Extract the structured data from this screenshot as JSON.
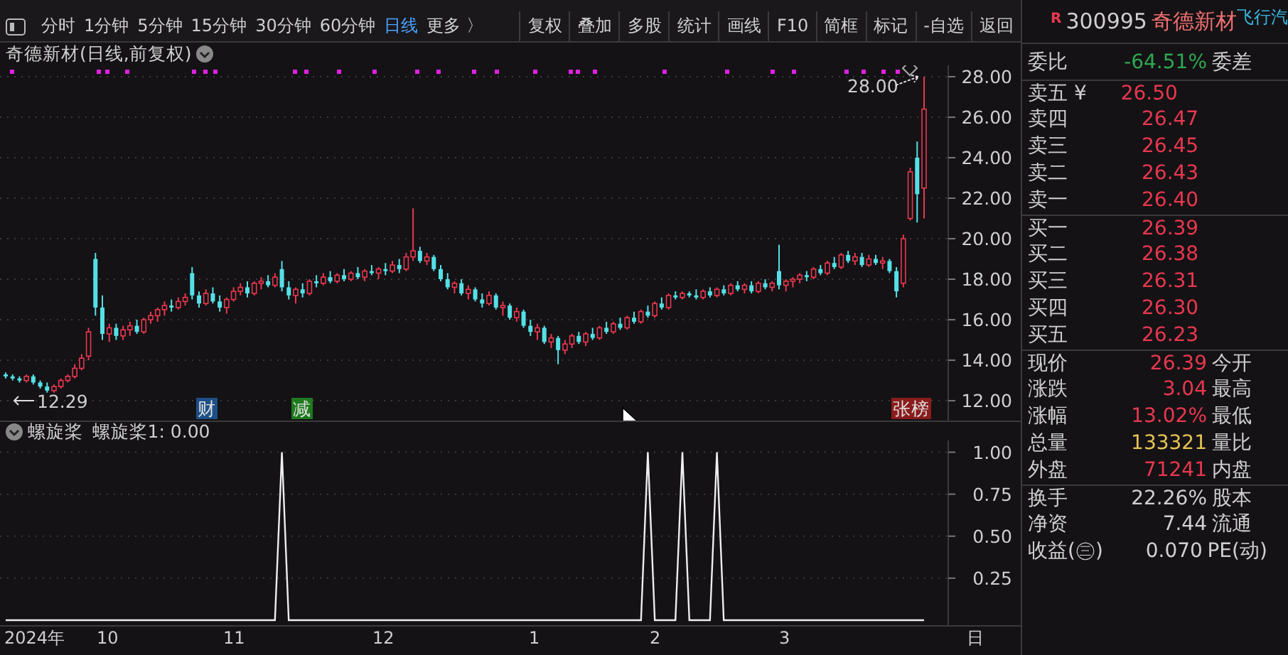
{
  "toolbar": {
    "periods": [
      {
        "label": "分时",
        "selected": false
      },
      {
        "label": "1分钟",
        "selected": false
      },
      {
        "label": "5分钟",
        "selected": false
      },
      {
        "label": "15分钟",
        "selected": false
      },
      {
        "label": "30分钟",
        "selected": false
      },
      {
        "label": "60分钟",
        "selected": false
      },
      {
        "label": "日线",
        "selected": true
      },
      {
        "label": "更多 〉",
        "selected": false
      }
    ],
    "buttons": [
      "复权",
      "叠加",
      "多股",
      "统计",
      "画线",
      "F10",
      "简框",
      "标记",
      "-自选",
      "返回"
    ]
  },
  "chart": {
    "title": "奇德新材(日线,前复权)",
    "high_label": "28.00",
    "low_label": "12.29",
    "chart_data": {
      "type": "candlestick",
      "grid": true,
      "ylim": [
        11.02,
        28.56
      ],
      "yticks": [
        {
          "value": 28,
          "label": "28.00"
        },
        {
          "value": 26,
          "label": "26.00"
        },
        {
          "value": 24,
          "label": "24.00"
        },
        {
          "value": 22,
          "label": "22.00"
        },
        {
          "value": 20,
          "label": "20.00"
        },
        {
          "value": 18,
          "label": "18.00"
        },
        {
          "value": 16,
          "label": "16.00"
        },
        {
          "value": 14,
          "label": "14.00"
        },
        {
          "value": 12,
          "label": "12.00"
        }
      ],
      "ohlc": [
        [
          13.3,
          13.4,
          13.1,
          13.2
        ],
        [
          13.2,
          13.3,
          13.0,
          13.1
        ],
        [
          13.1,
          13.2,
          12.9,
          13.0
        ],
        [
          13.0,
          13.3,
          12.9,
          13.2
        ],
        [
          13.2,
          13.3,
          12.8,
          12.9
        ],
        [
          12.9,
          13.0,
          12.6,
          12.7
        ],
        [
          12.7,
          12.9,
          12.4,
          12.5
        ],
        [
          12.5,
          12.8,
          12.4,
          12.7
        ],
        [
          12.7,
          13.1,
          12.6,
          13.0
        ],
        [
          13.0,
          13.3,
          12.9,
          13.2
        ],
        [
          13.2,
          13.8,
          13.1,
          13.6
        ],
        [
          13.6,
          14.3,
          13.5,
          14.1
        ],
        [
          14.2,
          15.6,
          14.0,
          15.4
        ],
        [
          19.0,
          19.3,
          16.2,
          16.6
        ],
        [
          16.6,
          17.2,
          15.0,
          15.3
        ],
        [
          15.3,
          15.8,
          14.9,
          15.6
        ],
        [
          15.6,
          15.8,
          15.0,
          15.2
        ],
        [
          15.2,
          15.7,
          15.0,
          15.5
        ],
        [
          15.5,
          15.9,
          15.2,
          15.7
        ],
        [
          15.7,
          16.0,
          15.3,
          15.4
        ],
        [
          15.4,
          16.1,
          15.3,
          16.0
        ],
        [
          16.0,
          16.4,
          15.8,
          16.2
        ],
        [
          16.2,
          16.6,
          15.9,
          16.5
        ],
        [
          16.5,
          16.9,
          16.2,
          16.7
        ],
        [
          16.7,
          17.0,
          16.4,
          16.6
        ],
        [
          16.6,
          17.1,
          16.5,
          16.9
        ],
        [
          16.9,
          17.3,
          16.7,
          17.1
        ],
        [
          18.3,
          18.6,
          17.0,
          17.2
        ],
        [
          17.2,
          17.4,
          16.6,
          16.8
        ],
        [
          16.8,
          17.5,
          16.7,
          17.3
        ],
        [
          17.3,
          17.6,
          16.8,
          16.9
        ],
        [
          16.9,
          17.2,
          16.4,
          16.6
        ],
        [
          16.6,
          17.1,
          16.3,
          17.0
        ],
        [
          17.0,
          17.6,
          16.9,
          17.4
        ],
        [
          17.4,
          17.8,
          17.2,
          17.6
        ],
        [
          17.6,
          17.9,
          17.1,
          17.3
        ],
        [
          17.3,
          17.9,
          17.2,
          17.8
        ],
        [
          17.8,
          18.1,
          17.5,
          17.9
        ],
        [
          17.9,
          18.2,
          17.6,
          17.7
        ],
        [
          17.7,
          18.3,
          17.6,
          18.1
        ],
        [
          18.5,
          18.9,
          17.4,
          17.6
        ],
        [
          17.6,
          17.9,
          17.0,
          17.2
        ],
        [
          17.2,
          17.6,
          16.8,
          17.5
        ],
        [
          17.5,
          17.8,
          17.1,
          17.3
        ],
        [
          17.3,
          18.0,
          17.2,
          17.9
        ],
        [
          17.9,
          18.2,
          17.6,
          17.8
        ],
        [
          17.8,
          18.3,
          17.7,
          18.1
        ],
        [
          18.1,
          18.4,
          17.8,
          17.9
        ],
        [
          17.9,
          18.3,
          17.8,
          18.2
        ],
        [
          18.2,
          18.5,
          17.9,
          18.0
        ],
        [
          18.0,
          18.4,
          17.9,
          18.3
        ],
        [
          18.3,
          18.6,
          18.0,
          18.1
        ],
        [
          18.1,
          18.5,
          17.9,
          18.4
        ],
        [
          18.4,
          18.7,
          18.2,
          18.3
        ],
        [
          18.3,
          18.6,
          18.0,
          18.5
        ],
        [
          18.5,
          18.8,
          18.2,
          18.4
        ],
        [
          18.4,
          18.9,
          18.3,
          18.7
        ],
        [
          18.7,
          19.0,
          18.3,
          18.5
        ],
        [
          18.5,
          19.3,
          18.4,
          19.1
        ],
        [
          19.1,
          21.5,
          18.9,
          19.4
        ],
        [
          19.4,
          19.6,
          18.8,
          18.9
        ],
        [
          18.9,
          19.3,
          18.7,
          19.1
        ],
        [
          19.1,
          19.2,
          18.4,
          18.5
        ],
        [
          18.5,
          18.7,
          17.9,
          18.0
        ],
        [
          18.0,
          18.3,
          17.5,
          17.6
        ],
        [
          17.6,
          17.9,
          17.3,
          17.8
        ],
        [
          17.8,
          18.0,
          17.2,
          17.3
        ],
        [
          17.3,
          17.7,
          17.0,
          17.5
        ],
        [
          17.5,
          17.6,
          16.9,
          17.0
        ],
        [
          17.0,
          17.3,
          16.6,
          16.8
        ],
        [
          16.8,
          17.4,
          16.7,
          17.2
        ],
        [
          17.2,
          17.3,
          16.5,
          16.6
        ],
        [
          16.6,
          16.9,
          16.2,
          16.7
        ],
        [
          16.7,
          16.8,
          16.0,
          16.1
        ],
        [
          16.1,
          16.6,
          15.9,
          16.4
        ],
        [
          16.4,
          16.5,
          15.6,
          15.7
        ],
        [
          15.7,
          16.0,
          15.2,
          15.4
        ],
        [
          15.4,
          15.8,
          15.0,
          15.6
        ],
        [
          15.6,
          15.7,
          14.8,
          14.9
        ],
        [
          14.9,
          15.3,
          14.6,
          15.1
        ],
        [
          15.1,
          15.2,
          13.8,
          14.5
        ],
        [
          14.5,
          15.0,
          14.3,
          14.8
        ],
        [
          14.8,
          15.3,
          14.6,
          15.2
        ],
        [
          15.2,
          15.4,
          14.8,
          14.9
        ],
        [
          14.9,
          15.4,
          14.7,
          15.3
        ],
        [
          15.3,
          15.6,
          15.0,
          15.1
        ],
        [
          15.1,
          15.7,
          15.0,
          15.6
        ],
        [
          15.6,
          15.9,
          15.3,
          15.4
        ],
        [
          15.4,
          15.9,
          15.3,
          15.8
        ],
        [
          15.8,
          16.1,
          15.5,
          15.6
        ],
        [
          15.6,
          16.2,
          15.5,
          16.1
        ],
        [
          16.1,
          16.4,
          15.8,
          15.9
        ],
        [
          15.9,
          16.5,
          15.8,
          16.4
        ],
        [
          16.4,
          16.7,
          16.1,
          16.2
        ],
        [
          16.2,
          16.9,
          16.1,
          16.8
        ],
        [
          16.8,
          17.1,
          16.5,
          16.6
        ],
        [
          16.6,
          17.3,
          16.5,
          17.2
        ],
        [
          17.2,
          17.4,
          17.0,
          17.1
        ],
        [
          17.1,
          17.4,
          17.0,
          17.3
        ],
        [
          17.3,
          17.4,
          17.1,
          17.2
        ],
        [
          17.2,
          17.5,
          17.0,
          17.1
        ],
        [
          17.1,
          17.5,
          17.0,
          17.4
        ],
        [
          17.4,
          17.6,
          17.1,
          17.2
        ],
        [
          17.2,
          17.6,
          17.1,
          17.5
        ],
        [
          17.5,
          17.7,
          17.2,
          17.3
        ],
        [
          17.3,
          17.8,
          17.2,
          17.7
        ],
        [
          17.7,
          17.9,
          17.4,
          17.5
        ],
        [
          17.5,
          17.8,
          17.3,
          17.7
        ],
        [
          17.7,
          17.9,
          17.3,
          17.4
        ],
        [
          17.4,
          17.9,
          17.3,
          17.8
        ],
        [
          17.8,
          18.0,
          17.5,
          17.6
        ],
        [
          17.6,
          17.9,
          17.4,
          17.8
        ],
        [
          18.4,
          19.7,
          17.5,
          17.7
        ],
        [
          17.7,
          18.0,
          17.4,
          17.9
        ],
        [
          17.9,
          18.1,
          17.6,
          18.0
        ],
        [
          18.0,
          18.3,
          17.8,
          18.2
        ],
        [
          18.2,
          18.4,
          17.9,
          18.1
        ],
        [
          18.1,
          18.6,
          18.0,
          18.5
        ],
        [
          18.5,
          18.7,
          18.2,
          18.3
        ],
        [
          18.3,
          18.9,
          18.2,
          18.8
        ],
        [
          18.8,
          19.1,
          18.5,
          18.6
        ],
        [
          18.6,
          19.3,
          18.5,
          19.2
        ],
        [
          19.2,
          19.4,
          18.8,
          18.9
        ],
        [
          18.9,
          19.3,
          18.7,
          19.1
        ],
        [
          19.1,
          19.3,
          18.6,
          18.7
        ],
        [
          18.7,
          19.2,
          18.6,
          19.0
        ],
        [
          19.0,
          19.2,
          18.7,
          18.8
        ],
        [
          18.8,
          19.1,
          18.5,
          18.9
        ],
        [
          18.9,
          19.0,
          18.3,
          18.4
        ],
        [
          18.4,
          18.6,
          17.1,
          17.4
        ],
        [
          17.8,
          20.2,
          17.6,
          20.0
        ],
        [
          21.0,
          23.5,
          20.9,
          23.3
        ],
        [
          24.0,
          24.8,
          20.8,
          22.2
        ],
        [
          22.5,
          28.0,
          21.0,
          26.4
        ]
      ]
    },
    "events": [
      {
        "label": "财",
        "color": "#1d4f86"
      },
      {
        "label": "减",
        "color": "#1e7a1e"
      },
      {
        "label": "张榜",
        "color": "#8a1c1c"
      }
    ]
  },
  "indicator": {
    "title": "螺旋桨",
    "value": "螺旋桨1: 0.00",
    "chart_data": {
      "type": "line",
      "grid": true,
      "ylim": [
        -0.03,
        1.07
      ],
      "yticks": [
        {
          "value": 1,
          "label": "1.00"
        },
        {
          "value": 0.75,
          "label": "0.75"
        },
        {
          "value": 0.5,
          "label": "0.50"
        },
        {
          "value": 0.25,
          "label": "0.25"
        }
      ],
      "series": [
        {
          "color": "#eeeeee",
          "values": [
            0,
            0,
            0,
            0,
            0,
            0,
            0,
            0,
            0,
            0,
            0,
            0,
            0,
            0,
            0,
            0,
            0,
            0,
            0,
            0,
            0,
            0,
            0,
            0,
            0,
            0,
            0,
            0,
            0,
            0,
            0,
            0,
            0,
            0,
            0,
            0,
            0,
            0,
            0,
            0,
            1,
            0,
            0,
            0,
            0,
            0,
            0,
            0,
            0,
            0,
            0,
            0,
            0,
            0,
            0,
            0,
            0,
            0,
            0,
            0,
            0,
            0,
            0,
            0,
            0,
            0,
            0,
            0,
            0,
            0,
            0,
            0,
            0,
            0,
            0,
            0,
            0,
            0,
            0,
            0,
            0,
            0,
            0,
            0,
            0,
            0,
            0,
            0,
            0,
            0,
            0,
            0,
            0,
            1,
            0,
            0,
            0,
            0,
            1,
            0,
            0,
            0,
            0,
            1,
            0,
            0,
            0,
            0,
            0,
            0,
            0,
            0,
            0,
            0,
            0,
            0,
            0,
            0,
            0,
            0,
            0,
            0,
            0,
            0,
            0,
            0,
            0,
            0,
            0,
            0,
            0,
            0,
            0,
            0
          ]
        }
      ]
    }
  },
  "date_axis": {
    "labels": [
      "2024年",
      "10",
      "11",
      "12",
      "1",
      "2",
      "3"
    ],
    "mode": "日"
  },
  "quote": {
    "badge": "R",
    "code": "300995",
    "name": "奇德新材",
    "extra": "飞行汽",
    "ratio": {
      "label": "委比",
      "value": "-64.51%",
      "label2": "委差",
      "color": "#2fa84f"
    },
    "asks": [
      {
        "label": "卖五 ¥",
        "price": "26.50"
      },
      {
        "label": "卖四",
        "price": "26.47"
      },
      {
        "label": "卖三",
        "price": "26.45"
      },
      {
        "label": "卖二",
        "price": "26.43"
      },
      {
        "label": "卖一",
        "price": "26.40"
      }
    ],
    "bids": [
      {
        "label": "买一",
        "price": "26.39"
      },
      {
        "label": "买二",
        "price": "26.38"
      },
      {
        "label": "买三",
        "price": "26.31"
      },
      {
        "label": "买四",
        "price": "26.30"
      },
      {
        "label": "买五",
        "price": "26.23"
      }
    ],
    "stats": [
      {
        "label": "现价",
        "value": "26.39",
        "label2": "今开",
        "color": "#e8384f"
      },
      {
        "label": "涨跌",
        "value": "3.04",
        "label2": "最高",
        "color": "#e8384f"
      },
      {
        "label": "涨幅",
        "value": "13.02%",
        "label2": "最低",
        "color": "#e8384f"
      },
      {
        "label": "总量",
        "value": "133321",
        "label2": "量比",
        "color": "#e6c153"
      },
      {
        "label": "外盘",
        "value": "71241",
        "label2": "内盘",
        "color": "#e8384f"
      }
    ],
    "finance": [
      {
        "label": "换手",
        "value": "22.26%",
        "label2": "股本"
      },
      {
        "label": "净资",
        "value": "7.44",
        "label2": "流通"
      },
      {
        "label": "收益(㊂)",
        "value": "0.070",
        "label2": "PE(动)"
      }
    ]
  }
}
